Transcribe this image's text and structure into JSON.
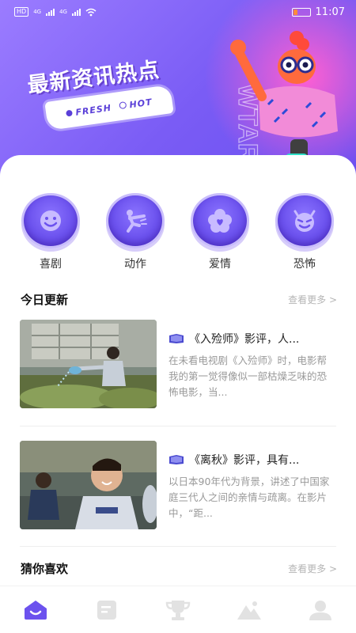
{
  "status_bar": {
    "left_badges": [
      "HD",
      "4G",
      "4G"
    ],
    "time": "11:07",
    "battery_level": 0.25
  },
  "banner": {
    "title": "最新资讯热点",
    "tags": [
      "FRESH",
      "HOT"
    ],
    "side_letters": "WTAR"
  },
  "genres": [
    {
      "label": "喜剧",
      "icon": "smile-face-icon"
    },
    {
      "label": "动作",
      "icon": "kick-figure-icon"
    },
    {
      "label": "爱情",
      "icon": "flower-heart-icon"
    },
    {
      "label": "恐怖",
      "icon": "devil-face-icon"
    }
  ],
  "today": {
    "title": "今日更新",
    "more": "查看更多 >",
    "articles": [
      {
        "title": "《入殓师》影评，人...",
        "summary": "在未看电视剧《入殓师》时，电影帮我的第一觉得像似一部枯燥乏味的恐怖电影，当..."
      },
      {
        "title": "《离秋》影评，具有...",
        "summary": "以日本90年代为背景，讲述了中国家庭三代人之间的亲情与疏离。在影片中，“距..."
      }
    ]
  },
  "guess": {
    "title": "猜你喜欢",
    "more": "查看更多 >"
  },
  "nav": {
    "items": [
      "home-icon",
      "document-icon",
      "trophy-icon",
      "mountain-icon",
      "profile-icon"
    ],
    "active_index": 0
  },
  "colors": {
    "accent": "#6c52ee",
    "nav_inactive": "#e2e2e2"
  }
}
